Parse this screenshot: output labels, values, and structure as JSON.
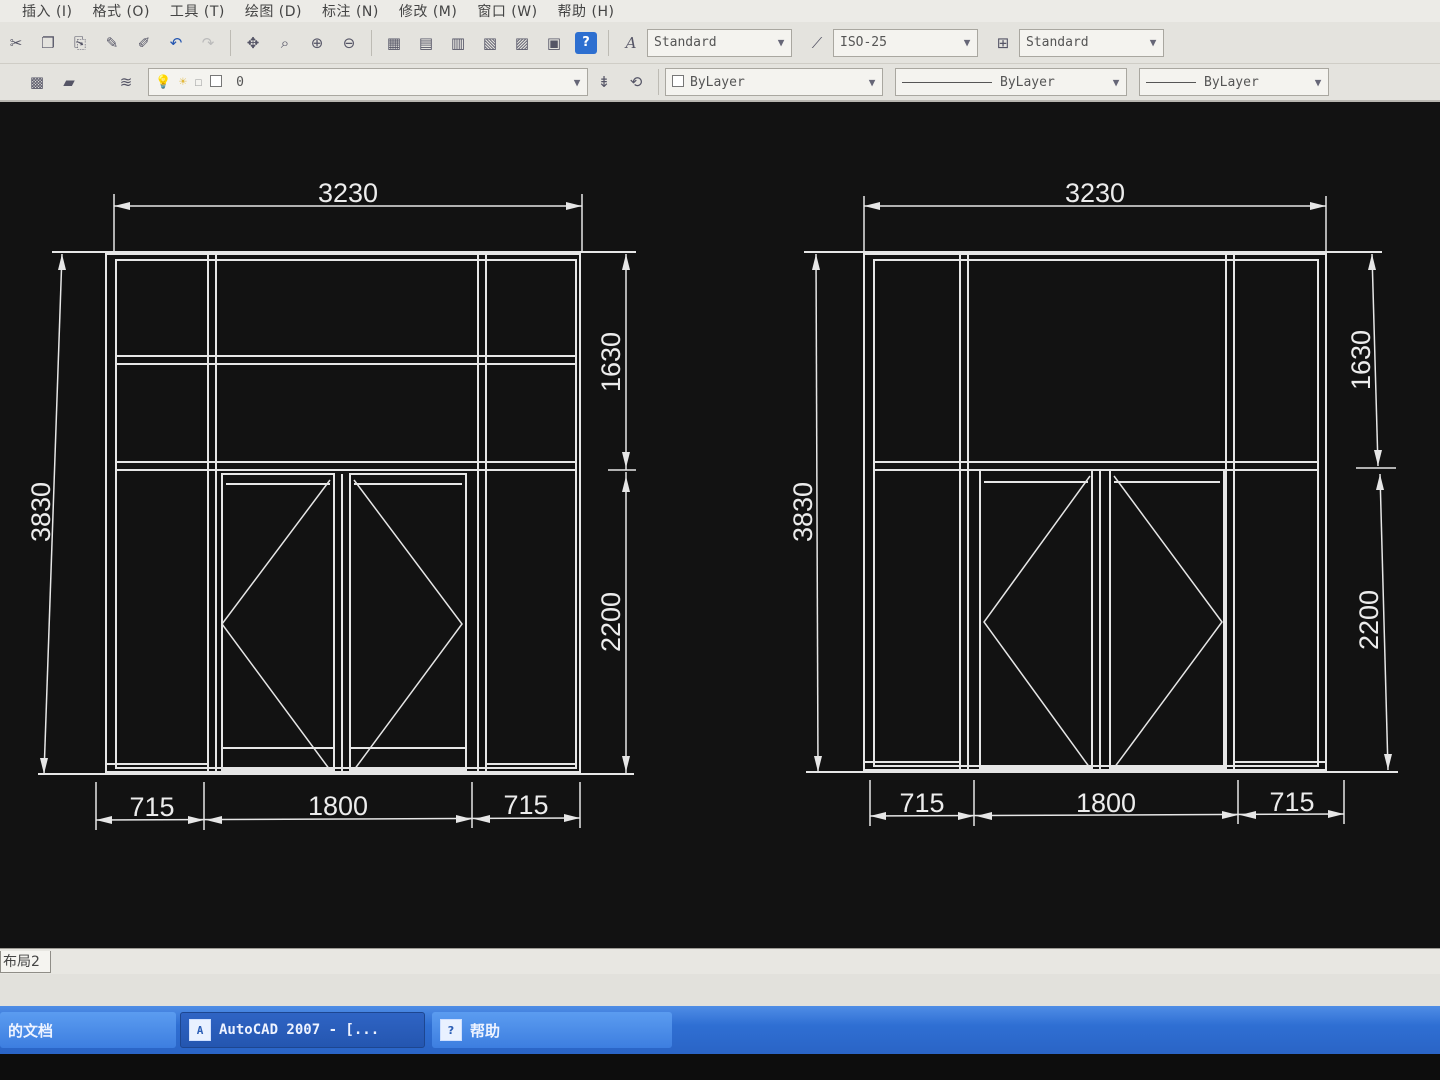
{
  "menu": {
    "items": [
      "插入 (I)",
      "格式 (O)",
      "工具 (T)",
      "绘图 (D)",
      "标注 (N)",
      "修改 (M)",
      "窗口 (W)",
      "帮助 (H)"
    ]
  },
  "toolbar_styles": {
    "text_style": "Standard",
    "dim_style": "ISO-25",
    "table_style": "Standard"
  },
  "toolbar_layers": {
    "layer_name": "0",
    "color": "ByLayer",
    "linetype": "ByLayer",
    "lineweight": "ByLayer"
  },
  "drawings": [
    {
      "total_width": "3230",
      "total_height": "3830",
      "upper_height": "1630",
      "lower_height": "2200",
      "left_width": "715",
      "center_width": "1800",
      "right_width": "715"
    },
    {
      "total_width": "3230",
      "total_height": "3830",
      "upper_height": "1630",
      "lower_height": "2200",
      "left_width": "715",
      "center_width": "1800",
      "right_width": "715"
    }
  ],
  "layout_tab": "布局2",
  "taskbar": {
    "docs_label": "的文档",
    "autocad_label": "AutoCAD 2007 - [...",
    "help_label": "帮助"
  },
  "colors": {
    "canvas": "#121212",
    "lines": "#e6e6e6",
    "taskbar": "#2f6fd3"
  }
}
